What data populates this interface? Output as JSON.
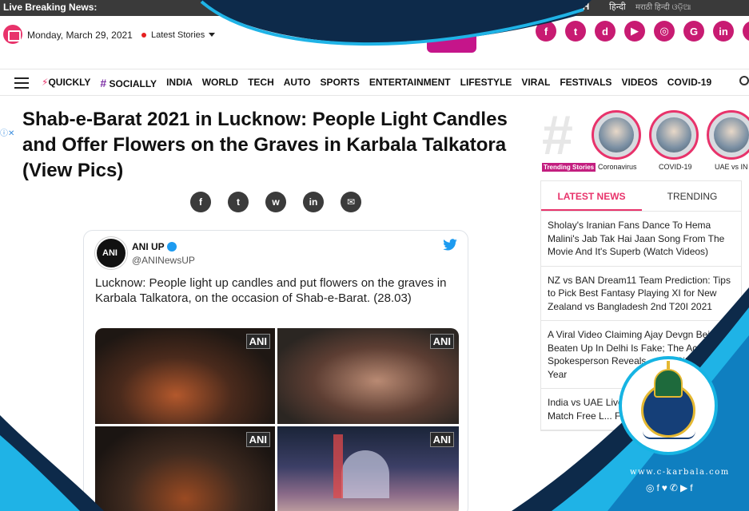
{
  "breaking": {
    "label": "Live Breaking News:",
    "lang_english": "LISH",
    "lang_hindi": "हिन्दी",
    "lang_other": "मराठी  हिन्दी  ଓଡ଼ିଆ"
  },
  "header": {
    "date": "Monday, March 29, 2021",
    "latest_stories": "Latest Stories",
    "socials": [
      {
        "icon": "facebook-icon",
        "glyph": "f"
      },
      {
        "icon": "twitter-icon",
        "glyph": "t"
      },
      {
        "icon": "dailyhunt-icon",
        "glyph": "d"
      },
      {
        "icon": "youtube-icon",
        "glyph": "▶"
      },
      {
        "icon": "instagram-icon",
        "glyph": "◎"
      },
      {
        "icon": "google-news-icon",
        "glyph": "G"
      },
      {
        "icon": "linkedin-icon",
        "glyph": "in"
      },
      {
        "icon": "more-icon",
        "glyph": "≡"
      }
    ],
    "accent": "#c81b72"
  },
  "nav": {
    "items": [
      "QUICKLY",
      "SOCIALLY",
      "INDIA",
      "WORLD",
      "TECH",
      "AUTO",
      "SPORTS",
      "ENTERTAINMENT",
      "LIFESTYLE",
      "VIRAL",
      "FESTIVALS",
      "VIDEOS",
      "COVID-19"
    ]
  },
  "article": {
    "headline": "Shab-e-Barat 2021 in Lucknow: People Light Candles and Offer Flowers on the Graves in Karbala Talkatora (View Pics)",
    "share": [
      {
        "icon": "facebook-icon",
        "glyph": "f"
      },
      {
        "icon": "twitter-icon",
        "glyph": "t"
      },
      {
        "icon": "whatsapp-icon",
        "glyph": "w"
      },
      {
        "icon": "linkedin-icon",
        "glyph": "in"
      },
      {
        "icon": "email-icon",
        "glyph": "✉"
      }
    ]
  },
  "tweet": {
    "name": "ANI UP",
    "handle": "@ANINewsUP",
    "text": "Lucknow: People light up candles and put flowers on the graves in Karbala Talkatora, on the occasion of Shab-e-Barat. (28.03)",
    "watermark": "ANI"
  },
  "sidebar": {
    "trending_stories_label": "Trending Stories",
    "stories": [
      "Coronavirus",
      "COVID-19",
      "UAE vs IN"
    ],
    "tabs": {
      "latest": "LATEST NEWS",
      "trending": "TRENDING"
    },
    "news": [
      "Sholay's Iranian Fans Dance To Hema Malini's Jab Tak Hai Jaan Song From The Movie And It's Superb (Watch Videos)",
      "NZ vs BAN Dream11 Team Prediction: Tips to Pick Best Fantasy Playing XI for New Zealand vs Bangladesh 2nd T20I 2021",
      "A Viral Video Claiming Ajay Devgn Being Beaten Up In Delhi Is Fake; The Actor's Spokesperson Reveals... The City For A Year",
      "India vs UAE Live... Get IND vs UAE... Match Free L... Football S..."
    ]
  },
  "overlay": {
    "url": "www.c-karbala.com",
    "icons": "◎f♥✆▶f"
  }
}
